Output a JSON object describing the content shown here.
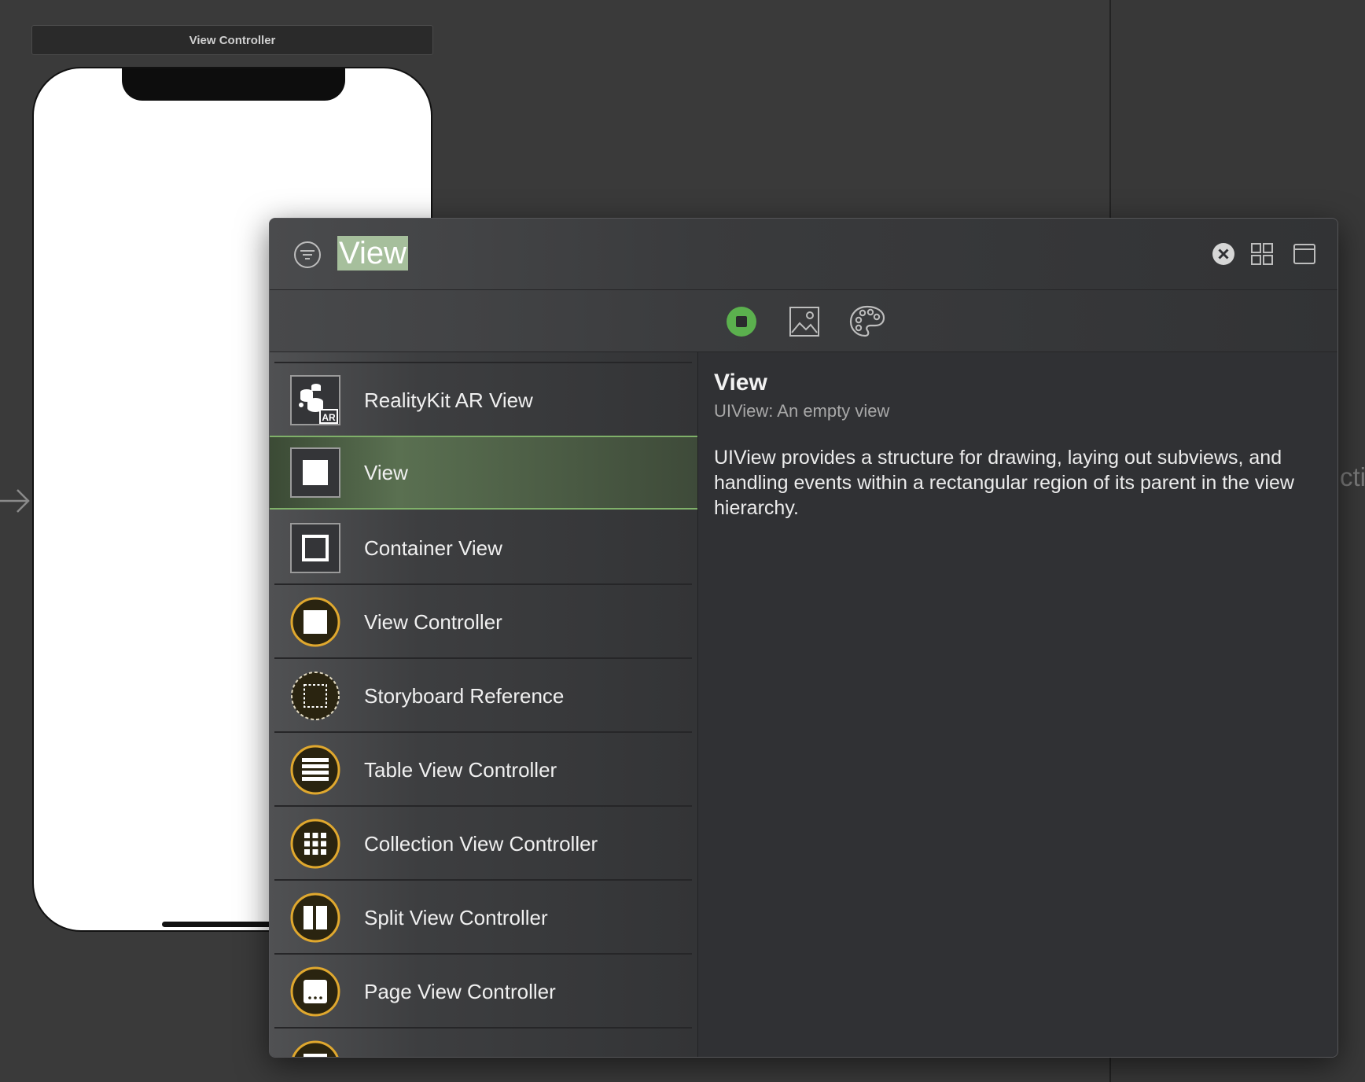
{
  "canvas": {
    "scene_title": "View Controller",
    "behind_text": "ctio"
  },
  "library": {
    "search": {
      "value": "View"
    },
    "tabs": [
      {
        "name": "objects",
        "icon": "stop-circle-icon",
        "active": true,
        "color": "#5bb04e"
      },
      {
        "name": "media",
        "icon": "photo-icon"
      },
      {
        "name": "colors",
        "icon": "palette-icon"
      }
    ],
    "items": [
      {
        "label": "RealityKit AR View",
        "icon": "realitykit-ar-icon"
      },
      {
        "label": "View",
        "icon": "view-icon",
        "selected": true
      },
      {
        "label": "Container View",
        "icon": "container-view-icon"
      },
      {
        "label": "View Controller",
        "icon": "view-controller-icon"
      },
      {
        "label": "Storyboard Reference",
        "icon": "storyboard-reference-icon"
      },
      {
        "label": "Table View Controller",
        "icon": "table-view-controller-icon"
      },
      {
        "label": "Collection View Controller",
        "icon": "collection-view-controller-icon"
      },
      {
        "label": "Split View Controller",
        "icon": "split-view-controller-icon"
      },
      {
        "label": "Page View Controller",
        "icon": "page-view-controller-icon"
      }
    ],
    "detail": {
      "title": "View",
      "subtitle": "UIView: An empty view",
      "description": "UIView provides a structure for drawing, laying out subviews, and handling events within a rectangular region of its parent in the view hierarchy."
    },
    "colors": {
      "accent_green": "#7fb069",
      "controller_gold": "#e0a82e",
      "controller_fill": "#2a2410"
    }
  }
}
